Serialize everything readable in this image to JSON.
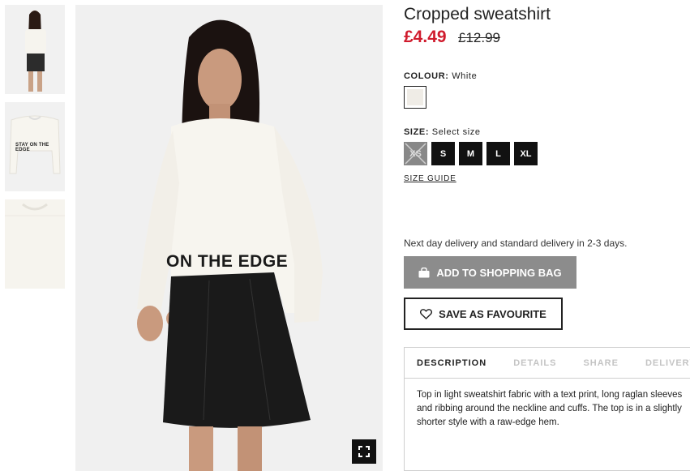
{
  "gallery": {
    "thumb_print_text": "STAY ON THE EDGE",
    "main_print_text": "ON THE EDGE"
  },
  "product": {
    "title": "Cropped sweatshirt",
    "price_current": "£4.49",
    "price_original": "£12.99",
    "colour_label": "COLOUR:",
    "colour_value": "White",
    "swatch_color": "#efece6",
    "size_label": "SIZE:",
    "size_value": "Select size",
    "sizes": [
      "XS",
      "S",
      "M",
      "L",
      "XL"
    ],
    "size_guide": "SIZE GUIDE",
    "delivery_note": "Next day delivery and standard delivery in 2-3 days.",
    "add_to_bag": "ADD TO SHOPPING BAG",
    "save_favourite": "SAVE AS FAVOURITE"
  },
  "details_tabs": {
    "tabs": [
      "DESCRIPTION",
      "DETAILS",
      "SHARE",
      "DELIVERY"
    ],
    "description": "Top in light sweatshirt fabric with a text print, long raglan sleeves and ribbing around the neckline and cuffs. The top is in a slightly shorter style with a raw-edge hem."
  },
  "colors": {
    "sale_red": "#d01b2d",
    "button_grey": "#8c8c8c",
    "size_black": "#111111"
  }
}
